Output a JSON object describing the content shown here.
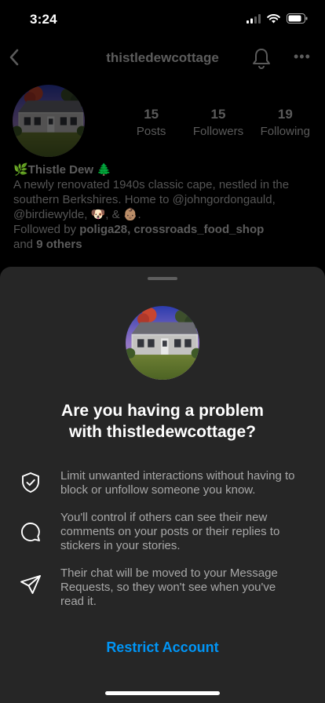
{
  "status": {
    "time": "3:24"
  },
  "nav": {
    "username": "thistledewcottage"
  },
  "profile": {
    "stats": [
      {
        "value": "15",
        "label": "Posts"
      },
      {
        "value": "15",
        "label": "Followers"
      },
      {
        "value": "19",
        "label": "Following"
      }
    ],
    "name_line": "🌿Thistle Dew 🌲",
    "bio_line1": "A newly renovated 1940s classic cape, nestled in the",
    "bio_line2": "southern Berkshires. Home to @johngordongauld,",
    "bio_line3": "@birdiewylde, 🐶, & 👶🏽.",
    "followed_by_prefix": "Followed by ",
    "followed_by_names": "poliga28, crossroads_food_shop",
    "followed_by_and": "and ",
    "followed_by_others": "9 others"
  },
  "sheet": {
    "title_line1": "Are you having a problem",
    "title_line2": "with thistledewcottage?",
    "items": [
      {
        "icon": "shield-check-icon",
        "text": "Limit unwanted interactions without having to block or unfollow someone you know."
      },
      {
        "icon": "comment-bubble-icon",
        "text": "You'll control if others can see their new comments on your posts or their replies to stickers in your stories."
      },
      {
        "icon": "paper-plane-icon",
        "text": "Their chat will be moved to your Message Requests, so they won't see when you've read it."
      }
    ],
    "action_label": "Restrict Account"
  },
  "colors": {
    "accent": "#0095f6",
    "sheet_bg": "#262626",
    "muted_text": "#a8a8a8"
  }
}
